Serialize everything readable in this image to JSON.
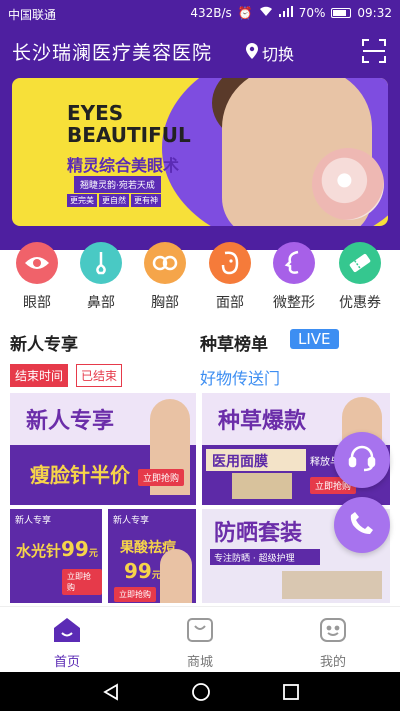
{
  "status_bar": {
    "carrier": "中国联通",
    "speed": "432B/s",
    "battery": "70%",
    "time": "09:32"
  },
  "header": {
    "hospital_name": "长沙瑞澜医疗美容医院",
    "location_label": "切换",
    "scan_icon": "scan-icon",
    "background": "#4e1fa0"
  },
  "banner": {
    "title_line1": "EYES",
    "title_line2": "BEAUTIFUL",
    "subtitle": "精灵综合美眼术",
    "tagline": "翘睫灵韵·宛若天成",
    "tags": [
      "更完美",
      "更自然",
      "更有神"
    ]
  },
  "categories": [
    {
      "label": "眼部",
      "icon": "eye-icon",
      "color": "#f0626a"
    },
    {
      "label": "鼻部",
      "icon": "nose-icon",
      "color": "#49c9c4"
    },
    {
      "label": "胸部",
      "icon": "chest-icon",
      "color": "#f5a54a"
    },
    {
      "label": "面部",
      "icon": "face-icon",
      "color": "#f57b3a"
    },
    {
      "label": "微整形",
      "icon": "profile-icon",
      "color": "#a760e8"
    },
    {
      "label": "优惠券",
      "icon": "ticket-icon",
      "color": "#35c78f"
    }
  ],
  "new_user": {
    "title": "新人专享",
    "end_label": "结束时间",
    "end_status": "已结束"
  },
  "trending": {
    "title": "种草榜单",
    "live_badge": "LIVE",
    "subtitle": "好物传送门"
  },
  "promos": {
    "new_user_banner": {
      "title": "新人专享",
      "headline": "瘦脸针半价",
      "button": "立即抢购"
    },
    "trend_banner": {
      "title": "种草爆款",
      "headline": "医用面膜",
      "side": "释放与生俱",
      "button": "立即抢购"
    },
    "hydro": {
      "tag": "新人专享",
      "headline": "水光针",
      "price": "99",
      "unit": "元",
      "button": "立即抢购"
    },
    "acid": {
      "tag": "新人专享",
      "headline": "果酸祛痘",
      "price": "99",
      "unit": "元",
      "button": "立即抢购"
    },
    "sunscreen": {
      "headline": "防晒套装",
      "sub": "专注防晒 · 超级护理"
    }
  },
  "tabs": [
    {
      "label": "首页",
      "icon": "home-icon",
      "active": true
    },
    {
      "label": "商城",
      "icon": "shop-icon",
      "active": false
    },
    {
      "label": "我的",
      "icon": "profile-smile-icon",
      "active": false
    }
  ],
  "colors": {
    "accent": "#5b2bb5",
    "live": "#3d8ef2",
    "alert": "#e63a4a"
  }
}
